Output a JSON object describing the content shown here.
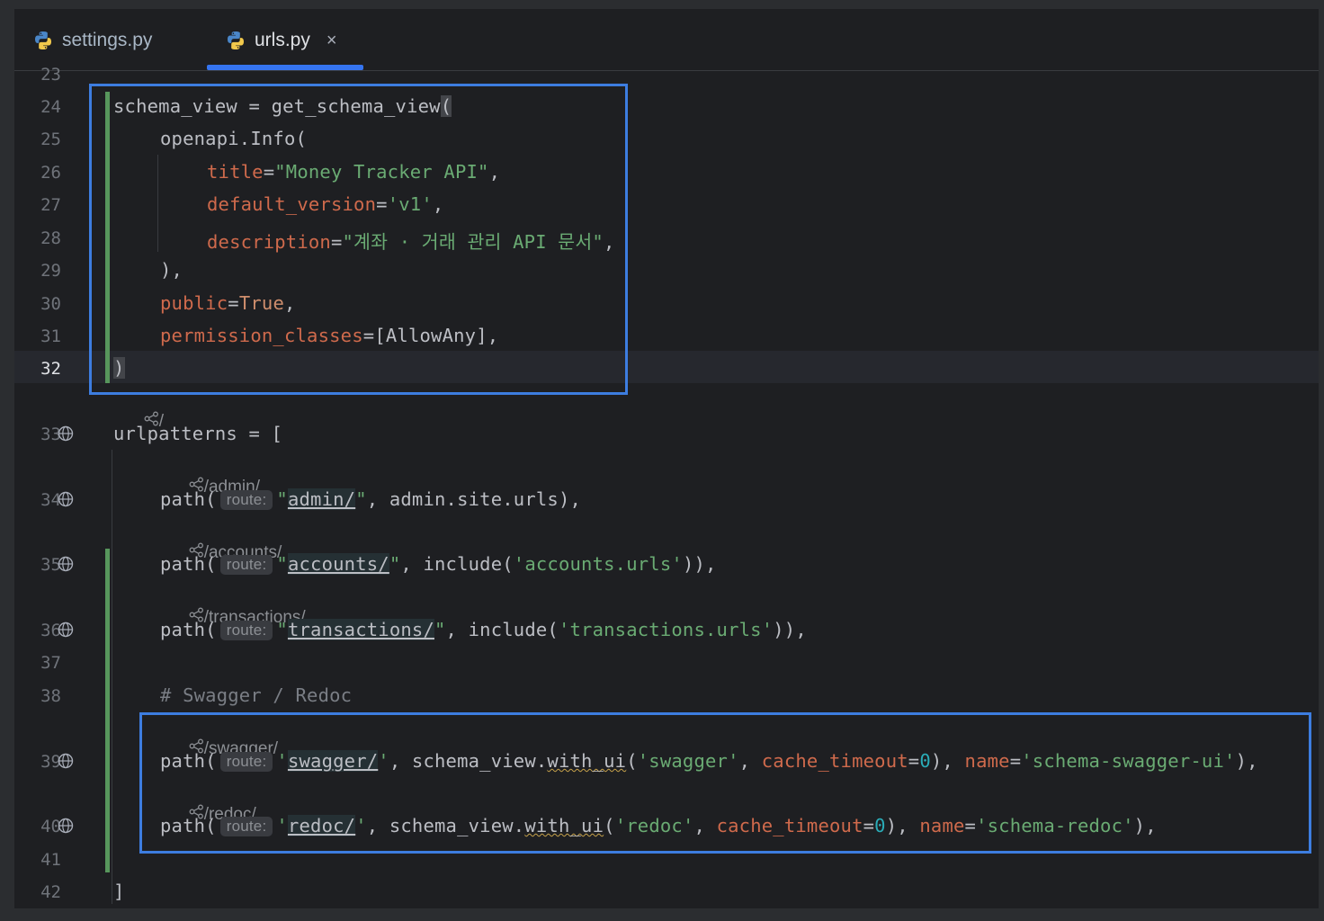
{
  "tabs": [
    {
      "label": "settings.py",
      "active": false,
      "icon": "python-icon"
    },
    {
      "label": "urls.py",
      "active": true,
      "icon": "python-icon",
      "closable": true
    }
  ],
  "close_glyph": "×",
  "line_numbers": {
    "l23": "23",
    "l24": "24",
    "l25": "25",
    "l26": "26",
    "l27": "27",
    "l28": "28",
    "l29": "29",
    "l30": "30",
    "l31": "31",
    "l32": "32",
    "l33": "33",
    "l34": "34",
    "l35": "35",
    "l36": "36",
    "l37": "37",
    "l38": "38",
    "l39": "39",
    "l40": "40",
    "l41": "41",
    "l42": "42"
  },
  "hints": {
    "root": "/",
    "admin": "/admin/",
    "accounts": "/accounts/",
    "transactions": "/transactions/",
    "swagger": "/swagger/",
    "redoc": "/redoc/",
    "route": "route:"
  },
  "code": {
    "l24a": "schema_view = get_schema_view",
    "l24b": "(",
    "l25": "openapi.Info(",
    "l26_param": "title",
    "l26_str": "\"Money Tracker API\"",
    "l27_param": "default_version",
    "l27_str": "'v1'",
    "l28_param": "description",
    "l28_str": "\"계좌 · 거래 관리 API 문서\"",
    "l29": "),",
    "l30_param": "public",
    "l30_val": "True",
    "l31_param": "permission_classes",
    "l31_val": "[AllowAny],",
    "l32": ")",
    "l33": "urlpatterns = [",
    "path": "path(",
    "l34_route": "admin/",
    "l34_rest": ", admin.site.urls),",
    "l35_route": "accounts/",
    "l35_mid": ", include(",
    "l35_str": "'accounts.urls'",
    "l35_end": ")),",
    "l36_route": "transactions/",
    "l36_mid": ", include(",
    "l36_str": "'transactions.urls'",
    "l36_end": ")),",
    "l38": "# Swagger / Redoc",
    "l39_route": "swagger/",
    "l39_a": ", schema_view.",
    "with_ui": "with_ui",
    "l39_str1": "'swagger'",
    "cache_timeout": "cache_timeout",
    "zero": "0",
    "name": "name",
    "l39_str2": "'schema-swagger-ui'",
    "l39_end": "),",
    "l40_route": "redoc/",
    "l40_str1": "'redoc'",
    "l40_str2": "'schema-redoc'",
    "l40_end": "),",
    "l42": "]"
  },
  "colors": {
    "highlight_box": "#3d7de0",
    "tab_underline": "#3574f0",
    "vcs_added_bar": "#57965c"
  }
}
